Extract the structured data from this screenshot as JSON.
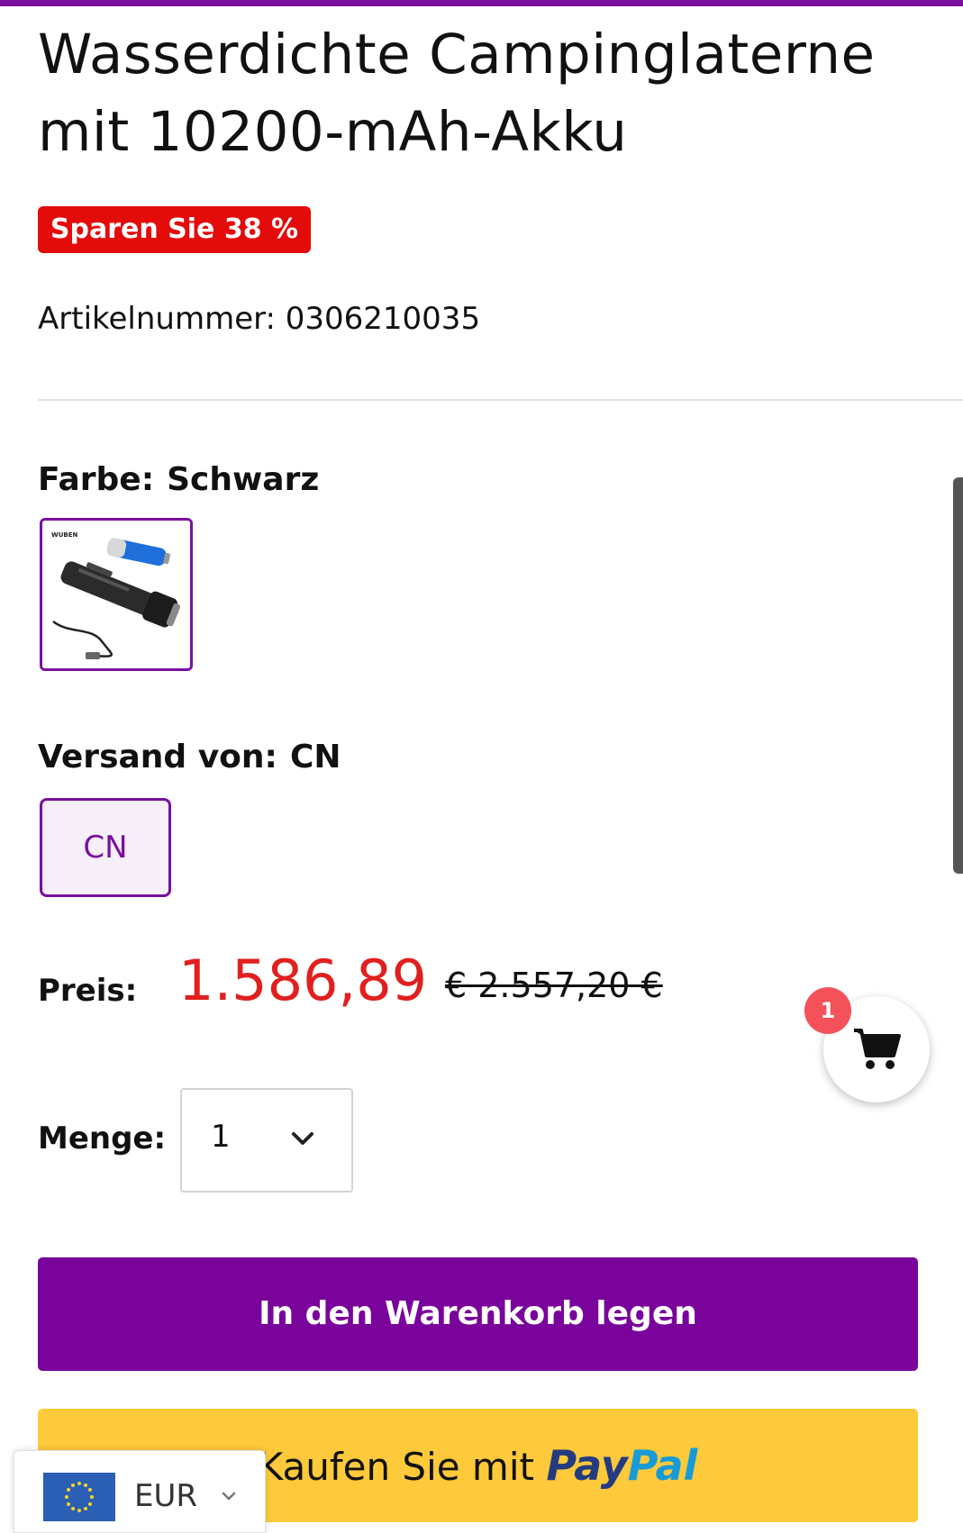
{
  "product": {
    "title": "Wasserdichte Campinglaterne mit 10200-mAh-Akku",
    "save_badge": "Sparen Sie 38 %",
    "sku": "Artikelnummer: 0306210035",
    "thumbnail_brand": "WUBEN"
  },
  "options": {
    "color_label": "Farbe:",
    "color_value": "Schwarz",
    "shipping_label": "Versand von:",
    "shipping_value": "CN",
    "shipping_option": "CN"
  },
  "pricing": {
    "price_label": "Preis:",
    "price": "1.586,89",
    "old_price": "€ 2.557,20 €"
  },
  "quantity": {
    "label": "Menge:",
    "value": "1"
  },
  "buttons": {
    "add_to_cart": "In den Warenkorb legen",
    "paypal_prefix": "Kaufen Sie mit",
    "paypal_brand_1": "Pay",
    "paypal_brand_2": "Pal"
  },
  "currency": {
    "code": "EUR",
    "flag_icon": "eu-flag-icon"
  },
  "cart": {
    "count": "1",
    "icon": "shopping-cart-icon"
  },
  "colors": {
    "accent": "#7a0f9e",
    "badge_red": "#e40b0b",
    "price_red": "#e0201f",
    "paypal_yellow": "#fec93a"
  }
}
